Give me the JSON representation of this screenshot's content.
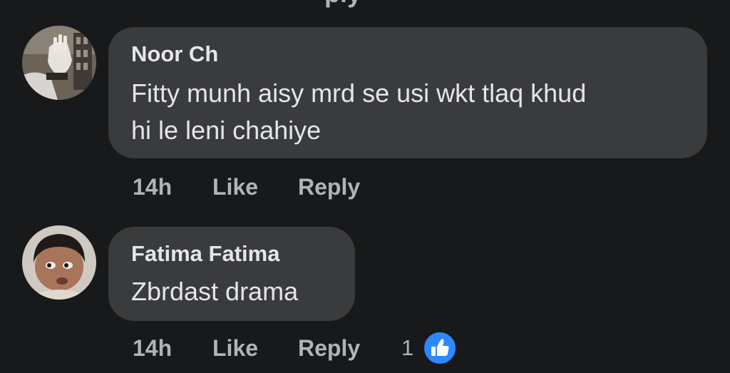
{
  "top_partial_text": "ply",
  "comments": [
    {
      "author": "Noor Ch",
      "text_line1": "Fitty munh aisy mrd se usi wkt tlaq khud",
      "text_line2": "hi le leni chahiye",
      "time": "14h",
      "like_label": "Like",
      "reply_label": "Reply"
    },
    {
      "author": "Fatima Fatima",
      "text_line1": "Zbrdast drama",
      "time": "14h",
      "like_label": "Like",
      "reply_label": "Reply",
      "reaction_count": "1",
      "reaction_icon": "thumbs-up-icon",
      "reaction_color": "#2d88ff"
    }
  ],
  "colors": {
    "background": "#18191a",
    "bubble": "#3a3b3c",
    "primary_text": "#e4e6eb",
    "secondary_text": "#b0b3b8",
    "like_blue": "#2d88ff"
  }
}
